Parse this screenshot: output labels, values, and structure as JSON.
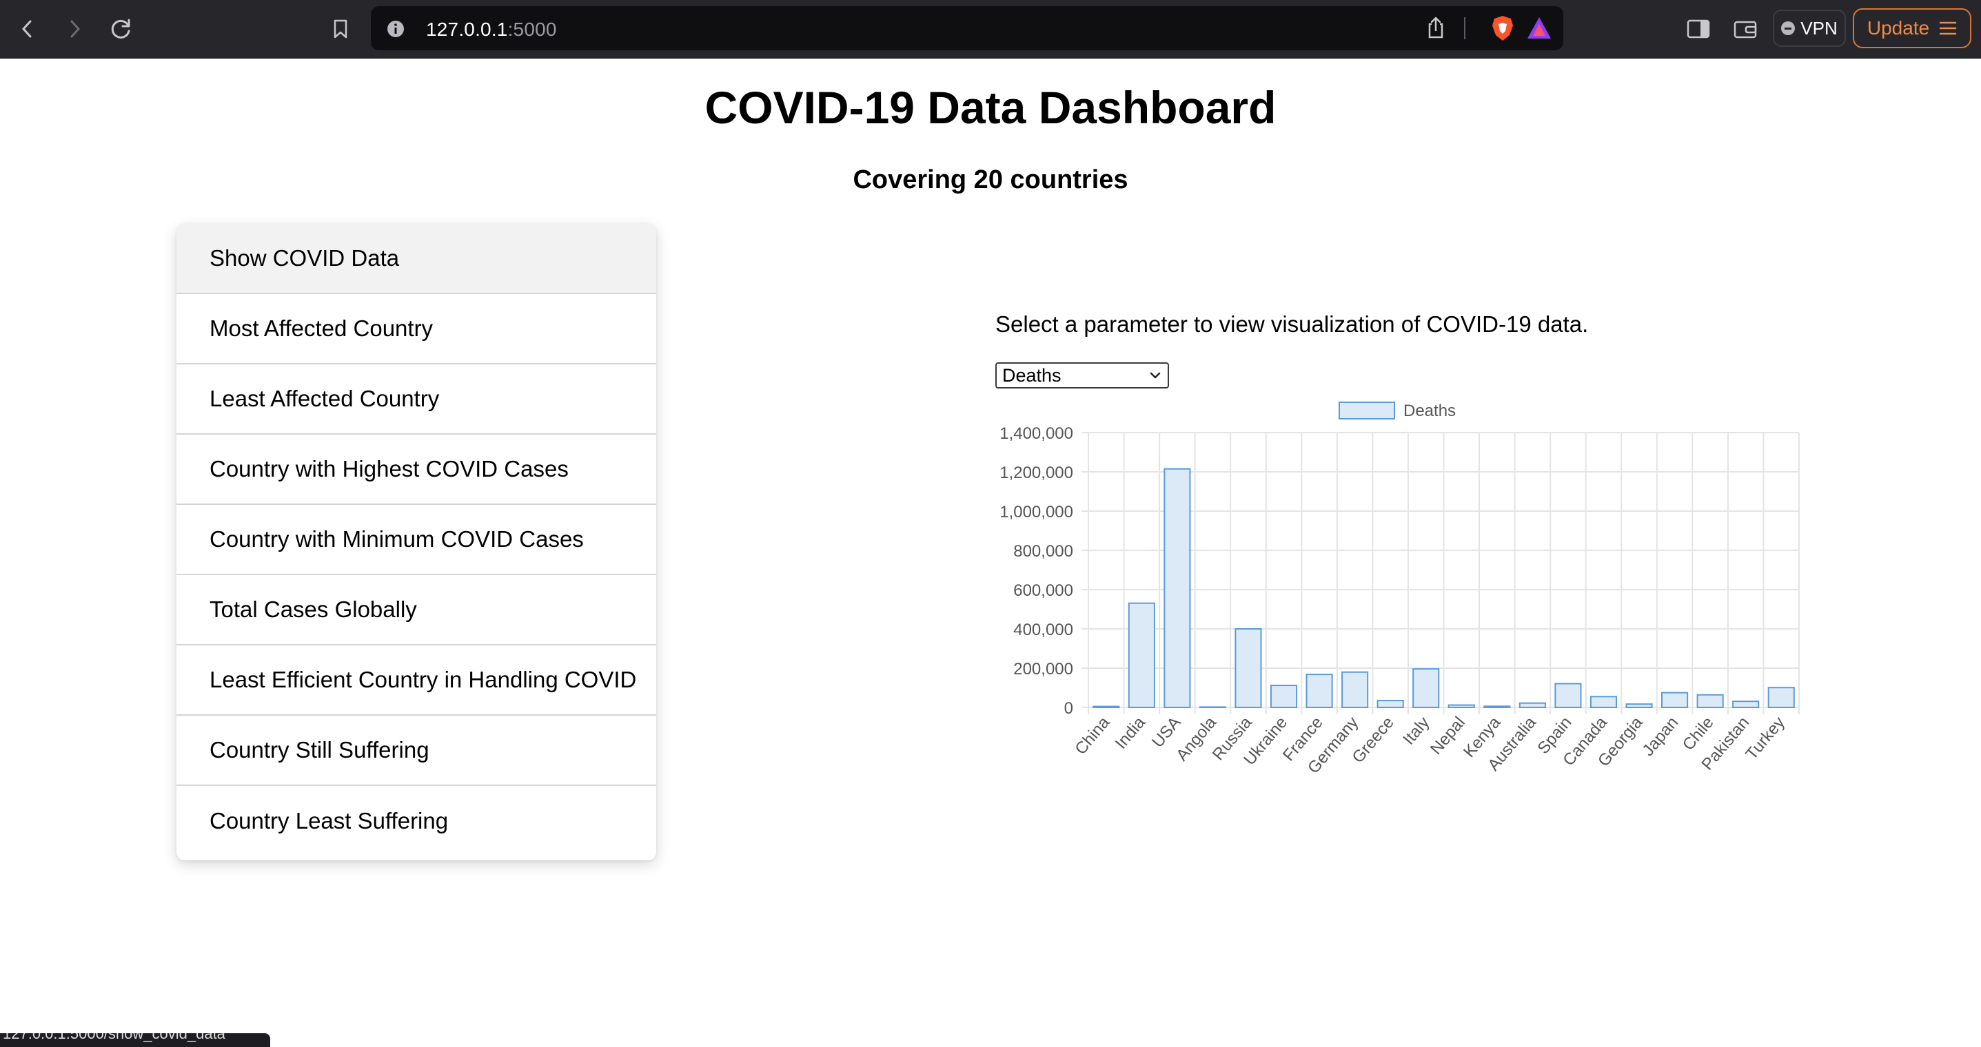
{
  "browser": {
    "url_host": "127.0.0.1",
    "url_port": ":5000",
    "vpn_label": "VPN",
    "update_label": "Update",
    "status_url": "127.0.0.1:5000/show_covid_data"
  },
  "page": {
    "title": "COVID-19 Data Dashboard",
    "subtitle": "Covering 20 countries",
    "prompt": "Select a parameter to view visualization of COVID-19 data."
  },
  "menu": {
    "items": [
      {
        "label": "Show COVID Data"
      },
      {
        "label": "Most Affected Country"
      },
      {
        "label": "Least Affected Country"
      },
      {
        "label": "Country with Highest COVID Cases"
      },
      {
        "label": "Country with Minimum COVID Cases"
      },
      {
        "label": "Total Cases Globally"
      },
      {
        "label": "Least Efficient Country in Handling COVID"
      },
      {
        "label": "Country Still Suffering"
      },
      {
        "label": "Country Least Suffering"
      }
    ]
  },
  "parameter_select": {
    "selected": "Deaths"
  },
  "colors": {
    "bar_fill": "#dceaf8",
    "bar_stroke": "#5b9bd8",
    "grid": "#e4e4e4",
    "axis_text": "#555555",
    "update_accent": "#f08a48"
  },
  "chart_data": {
    "type": "bar",
    "legend": "top",
    "grid": true,
    "categories": [
      "China",
      "India",
      "USA",
      "Angola",
      "Russia",
      "Ukraine",
      "France",
      "Germany",
      "Greece",
      "Italy",
      "Nepal",
      "Kenya",
      "Australia",
      "Spain",
      "Canada",
      "Georgia",
      "Japan",
      "Chile",
      "Pakistan",
      "Turkey"
    ],
    "series": [
      {
        "name": "Deaths",
        "values": [
          5000,
          531000,
          1215000,
          2000,
          400000,
          112000,
          168000,
          180000,
          35000,
          196000,
          12000,
          6000,
          22000,
          121000,
          55000,
          17000,
          75000,
          64000,
          31000,
          101000
        ]
      }
    ],
    "ylim": [
      0,
      1400000
    ],
    "yticks": [
      0,
      200000,
      400000,
      600000,
      800000,
      1000000,
      1200000,
      1400000
    ],
    "ytick_labels": [
      "0",
      "200,000",
      "400,000",
      "600,000",
      "800,000",
      "1,000,000",
      "1,200,000",
      "1,400,000"
    ]
  }
}
